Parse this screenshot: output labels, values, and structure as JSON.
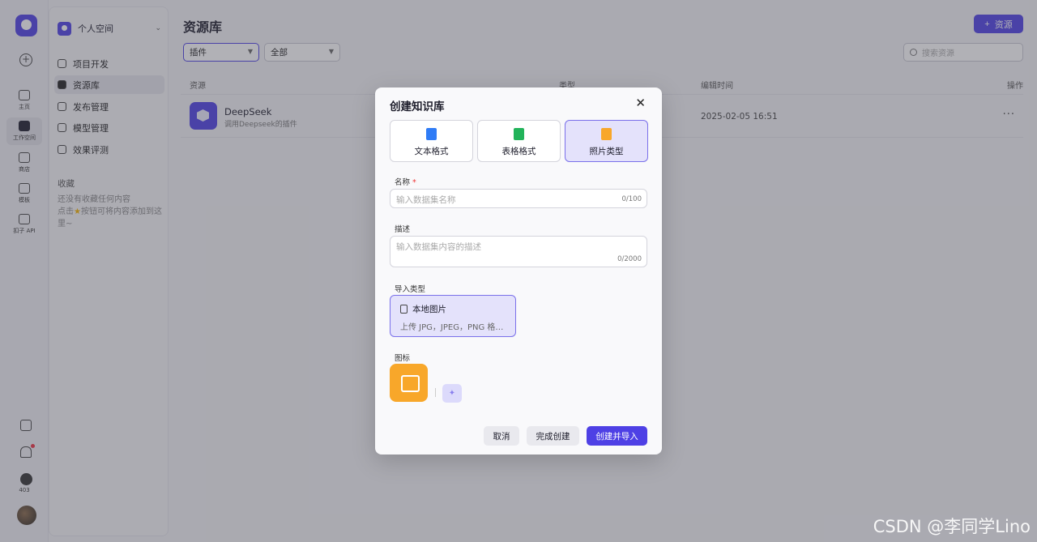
{
  "rail": {
    "items": [
      {
        "label": "主页",
        "icon": "home-icon"
      },
      {
        "label": "工作空间",
        "icon": "terminal-icon"
      },
      {
        "label": "商店",
        "icon": "store-icon"
      },
      {
        "label": "模板",
        "icon": "template-icon"
      },
      {
        "label": "扣子 API",
        "icon": "api-link-icon"
      }
    ],
    "badge_count": "403"
  },
  "sidebar": {
    "space_label": "个人空间",
    "nav": [
      {
        "label": "项目开发",
        "icon": "gamepad-icon"
      },
      {
        "label": "资源库",
        "icon": "library-icon"
      },
      {
        "label": "发布管理",
        "icon": "rocket-icon"
      },
      {
        "label": "模型管理",
        "icon": "cube-icon"
      },
      {
        "label": "效果评测",
        "icon": "gauge-icon"
      }
    ],
    "favorites_title": "收藏",
    "favorites_empty_1": "还没有收藏任何内容",
    "favorites_empty_2a": "点击",
    "favorites_empty_2b": "按钮可将内容添加到这里~"
  },
  "main": {
    "title": "资源库",
    "add_button": "资源",
    "filter_type": "插件",
    "filter_scope": "全部",
    "search_placeholder": "搜索资源",
    "columns": {
      "resource": "资源",
      "type": "类型",
      "edit_time": "编辑时间",
      "actions": "操作"
    },
    "rows": [
      {
        "name": "DeepSeek",
        "desc": "调用Deepseek的插件",
        "time": "2025-02-05 16:51",
        "more": "···"
      }
    ]
  },
  "modal": {
    "title": "创建知识库",
    "types": [
      {
        "label": "文本格式",
        "color": "#2f7cf6"
      },
      {
        "label": "表格格式",
        "color": "#22b35a"
      },
      {
        "label": "照片类型",
        "color": "#f8a72a"
      }
    ],
    "name_label": "名称",
    "name_required": "*",
    "name_placeholder": "输入数据集名称",
    "name_count": "0/100",
    "desc_label": "描述",
    "desc_placeholder": "输入数据集内容的描述",
    "desc_count": "0/2000",
    "import_label": "导入类型",
    "import_title": "本地图片",
    "import_desc": "上传 JPG，JPEG，PNG 格…",
    "icon_label": "图标",
    "cancel": "取消",
    "finish": "完成创建",
    "create_import": "创建并导入"
  },
  "watermark": "CSDN @李同学Lino",
  "colors": {
    "brand": "#4e40e5",
    "selected_bg": "#e4e2fb",
    "orange": "#f8a72a"
  }
}
